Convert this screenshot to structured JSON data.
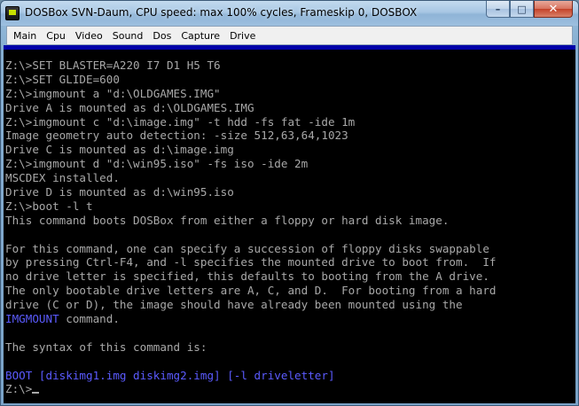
{
  "window": {
    "title": "DOSBox SVN-Daum, CPU speed: max 100% cycles, Frameskip  0,   DOSBOX",
    "minimize_glyph": "–",
    "maximize_glyph": "□",
    "close_glyph": "✕"
  },
  "menu": {
    "items": [
      "Main",
      "Cpu",
      "Video",
      "Sound",
      "Dos",
      "Capture",
      "Drive"
    ]
  },
  "terminal": {
    "lines": [
      "Z:\\>SET BLASTER=A220 I7 D1 H5 T6",
      "Z:\\>SET GLIDE=600",
      "Z:\\>imgmount a \"d:\\OLDGAMES.IMG\"",
      "Drive A is mounted as d:\\OLDGAMES.IMG",
      "Z:\\>imgmount c \"d:\\image.img\" -t hdd -fs fat -ide 1m",
      "Image geometry auto detection: -size 512,63,64,1023",
      "Drive C is mounted as d:\\image.img",
      "Z:\\>imgmount d \"d:\\win95.iso\" -fs iso -ide 2m",
      "MSCDEX installed.",
      "Drive D is mounted as d:\\win95.iso",
      "Z:\\>boot -l t",
      "This command boots DOSBox from either a floppy or hard disk image.",
      "",
      "For this command, one can specify a succession of floppy disks swappable",
      "by pressing Ctrl-F4, and -l specifies the mounted drive to boot from.  If",
      "no drive letter is specified, this defaults to booting from the A drive.",
      "The only bootable drive letters are A, C, and D.  For booting from a hard",
      "drive (C or D), the image should have already been mounted using the",
      "",
      "",
      "The syntax of this command is:",
      "",
      "BOOT [diskimg1.img diskimg2.img] [-l driveletter]",
      "Z:\\>"
    ],
    "imgmount_keyword": "IMGMOUNT",
    "imgmount_suffix": " command.",
    "text_color": "#a8a8a8",
    "highlight_color": "#5b5bff",
    "background_color": "#000000"
  }
}
